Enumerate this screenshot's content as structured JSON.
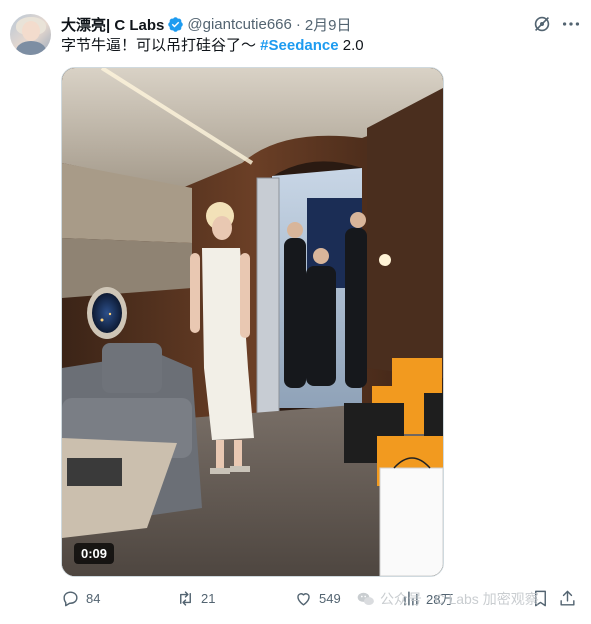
{
  "author": {
    "display_name": "大漂亮| C Labs",
    "handle": "@giantcutie666",
    "date": "2月9日",
    "separator": "·"
  },
  "tweet": {
    "text": "字节牛逼！可以吊打硅谷了～ ",
    "hashtag": "#Seedance",
    "hashtag_suffix": " 2.0"
  },
  "media": {
    "duration": "0:09"
  },
  "actions": {
    "replies": "84",
    "reposts": "21",
    "likes": "549",
    "views": "28万"
  },
  "watermark": {
    "text": "公众号 · C Labs 加密观察"
  },
  "colors": {
    "accent": "#1d9bf0",
    "secondary_text": "#536471",
    "primary_text": "#0f1419"
  },
  "icons": [
    "verified-badge-icon",
    "grok-icon",
    "more-icon",
    "reply-icon",
    "repost-icon",
    "like-icon",
    "views-icon",
    "bookmark-icon",
    "share-icon",
    "wechat-icon"
  ]
}
